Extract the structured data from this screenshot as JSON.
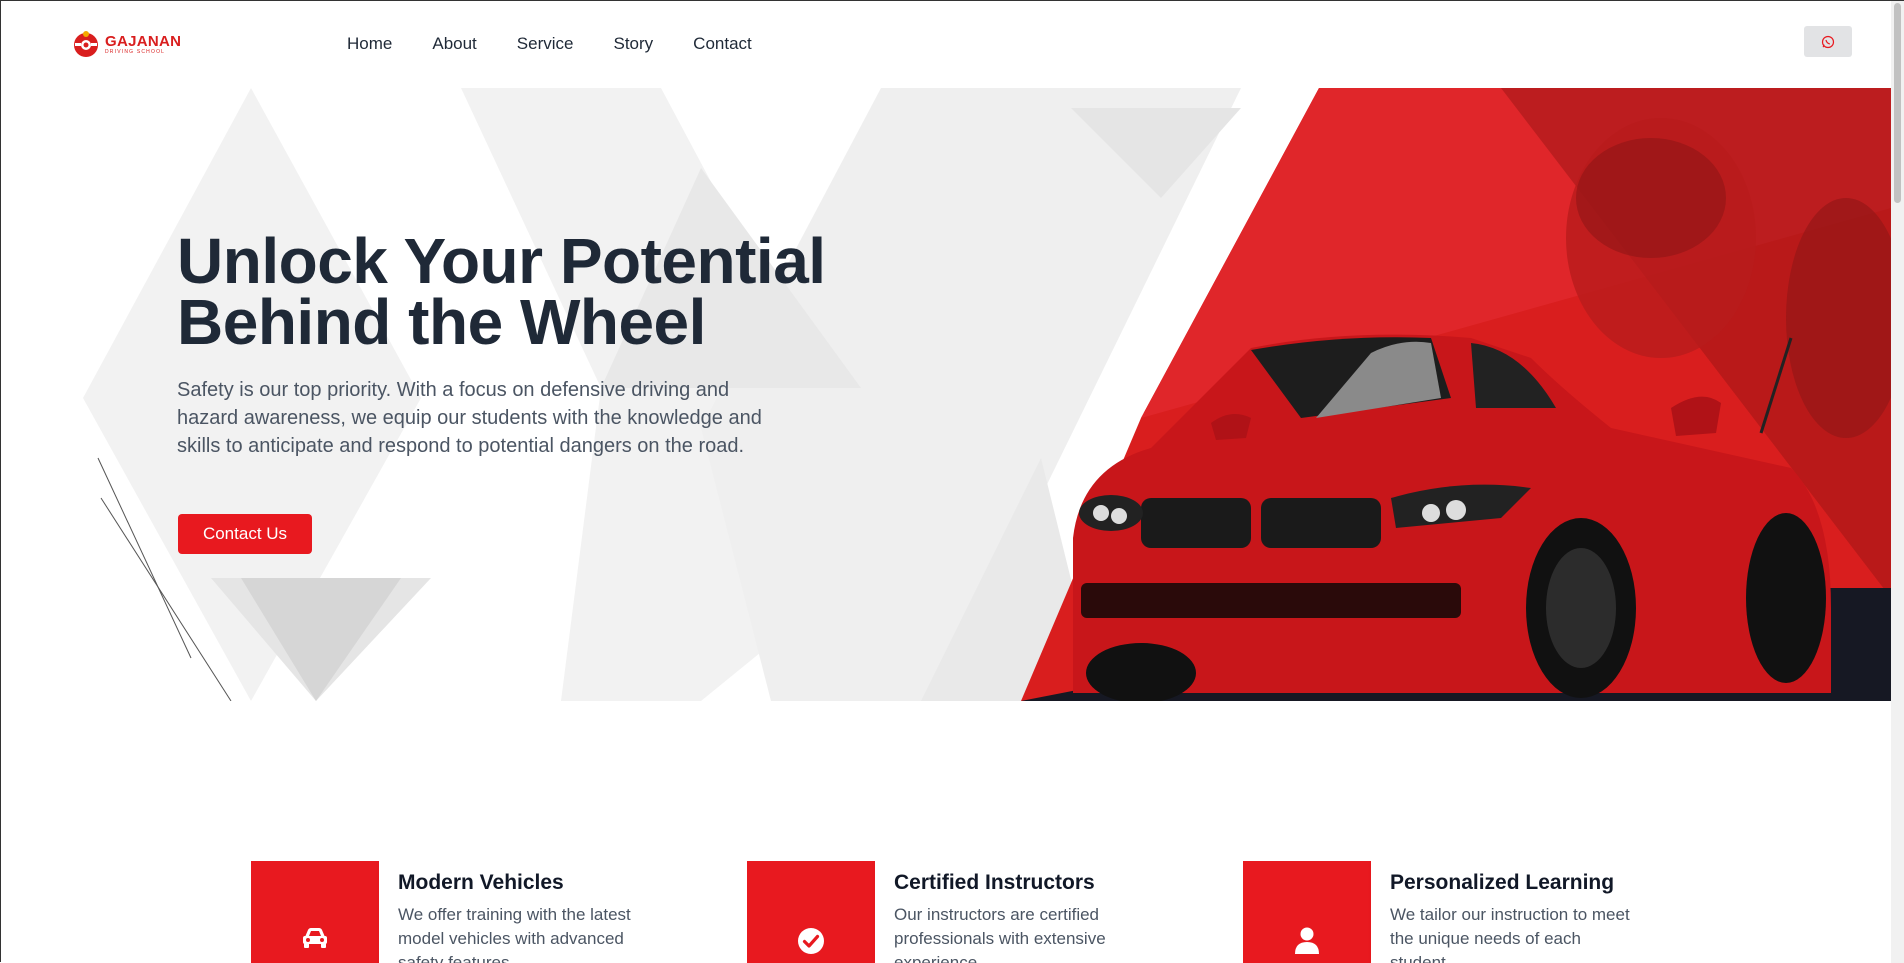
{
  "brand": {
    "name": "GAJANAN",
    "tagline": "DRIVING SCHOOL",
    "primary_color": "#e8191f",
    "dark_text_color": "#1f2937"
  },
  "nav": {
    "items": [
      {
        "label": "Home"
      },
      {
        "label": "About"
      },
      {
        "label": "Service"
      },
      {
        "label": "Story"
      },
      {
        "label": "Contact"
      }
    ],
    "whatsapp_icon": "whatsapp-icon"
  },
  "hero": {
    "title_line1": "Unlock Your Potential",
    "title_line2": "Behind the Wheel",
    "text": "Safety is our top priority. With a focus on defensive driving and hazard awareness, we equip our students with the knowledge and skills to anticipate and respond to potential dangers on the road.",
    "cta_label": "Contact Us",
    "image": "red-sports-car-with-smiling-driver"
  },
  "features": [
    {
      "title": "Modern Vehicles",
      "description": "We offer training with the latest model vehicles with advanced safety features",
      "icon": "car-icon"
    },
    {
      "title": "Certified Instructors",
      "description": "Our instructors are certified professionals with extensive experience",
      "icon": "check-circle-icon"
    },
    {
      "title": "Personalized Learning",
      "description": "We tailor our instruction to meet the unique needs of each student",
      "icon": "user-icon"
    }
  ]
}
